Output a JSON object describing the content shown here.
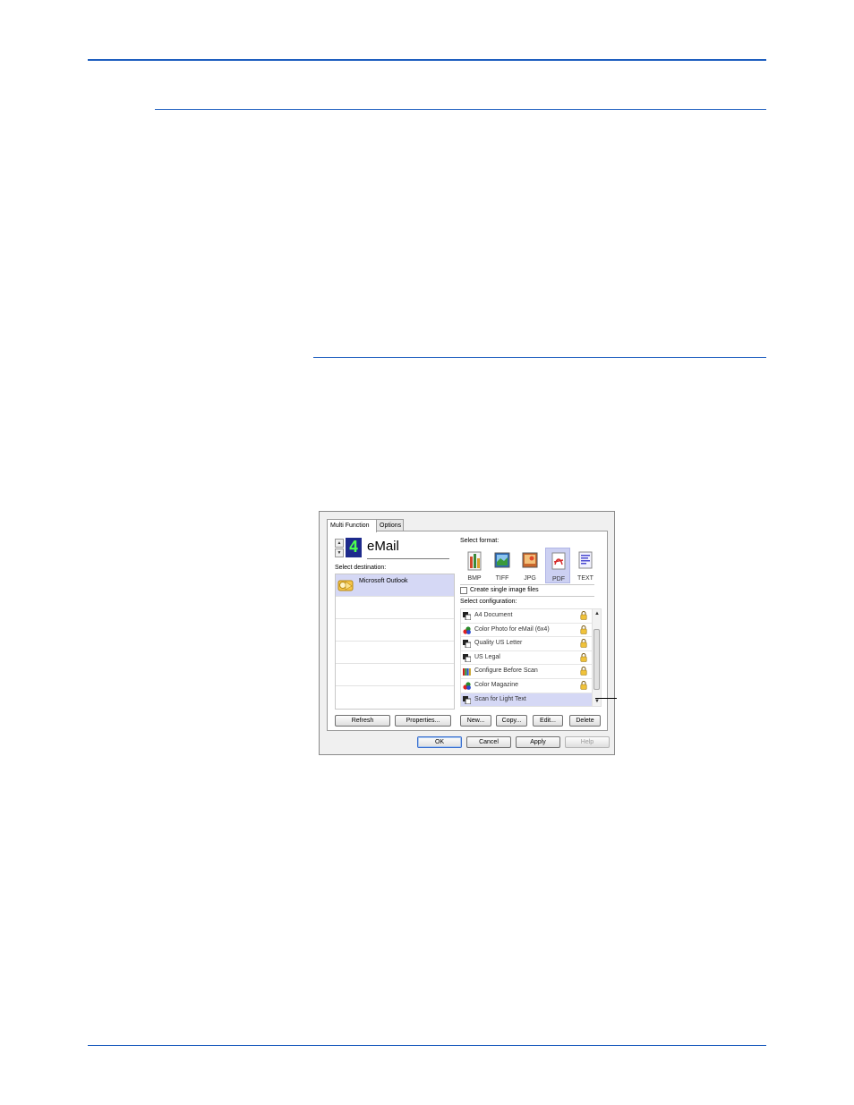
{
  "dialog": {
    "tabs": [
      "Multi Function",
      "Options"
    ],
    "destination_number": "4",
    "destination_title": "eMail",
    "select_destination_label": "Select destination:",
    "destinations": [
      "Microsoft Outlook"
    ],
    "refresh_label": "Refresh",
    "properties_label": "Properties...",
    "select_format_label": "Select format:",
    "formats": [
      "BMP",
      "TIFF",
      "JPG",
      "PDF",
      "TEXT"
    ],
    "selected_format": "PDF",
    "create_single_label": "Create single image files",
    "select_configuration_label": "Select configuration:",
    "configurations": [
      {
        "name": "A4 Document",
        "icon": "bw-config-icon",
        "locked": true
      },
      {
        "name": "Color Photo for eMail (6x4)",
        "icon": "color-config-icon",
        "locked": true
      },
      {
        "name": "Quality US Letter",
        "icon": "bw-config-icon",
        "locked": true
      },
      {
        "name": "US Legal",
        "icon": "bw-config-icon",
        "locked": true
      },
      {
        "name": "Configure Before Scan",
        "icon": "configure-icon",
        "locked": true
      },
      {
        "name": "Color Magazine",
        "icon": "color-config-icon",
        "locked": true
      },
      {
        "name": "Scan for Light Text",
        "icon": "bw-config-icon",
        "locked": false
      }
    ],
    "new_label": "New...",
    "copy_label": "Copy...",
    "edit_label": "Edit...",
    "delete_label": "Delete",
    "ok_label": "OK",
    "cancel_label": "Cancel",
    "apply_label": "Apply",
    "help_label": "Help"
  },
  "colors": {
    "rule": "#1f5fbf",
    "selection": "#d5d8f5",
    "digit_bg": "#1d2a8c",
    "digit_fg": "#4dff4d"
  }
}
